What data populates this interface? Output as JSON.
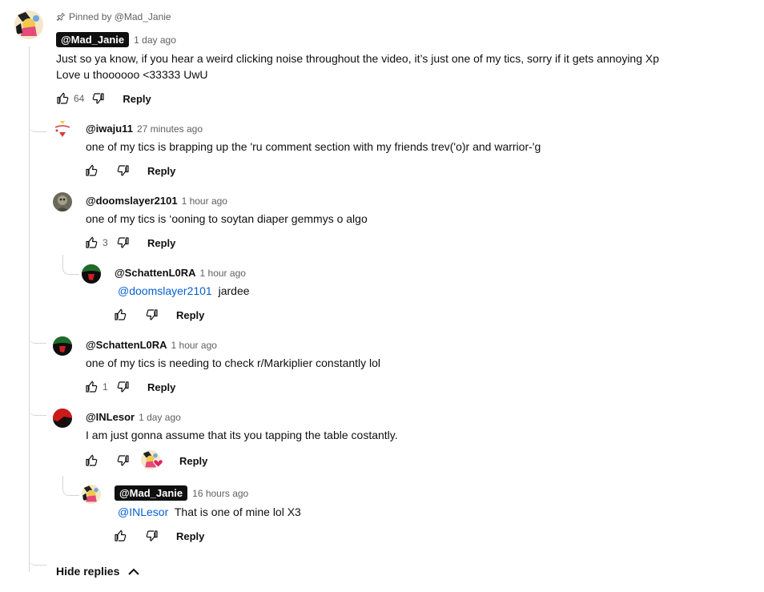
{
  "pinned": {
    "pin_text": "Pinned by @Mad_Janie",
    "handle": "@Mad_Janie",
    "time": "1 day ago",
    "lines": [
      "Just so ya know, if you hear a weird clicking noise throughout the video, it’s just one of my tics, sorry if it gets annoying Xp",
      "Love u thoooooo <33333 UwU"
    ],
    "likes": "64",
    "reply_label": "Reply"
  },
  "replies": [
    {
      "handle": "@iwaju11",
      "time": "27 minutes ago",
      "text": "one of my tics is brapping up the 'ru comment section with my friends trev('o)r and warrior-'g",
      "likes": "",
      "reply_label": "Reply"
    },
    {
      "handle": "@doomslayer2101",
      "time": "1 hour ago",
      "text": "one of my tics is ‘ooning to soytan diaper gemmys o algo",
      "likes": "3",
      "reply_label": "Reply"
    },
    {
      "handle": "@SchattenL0RA",
      "time": "1 hour ago",
      "mention": "@doomslayer2101",
      "text": "jardee",
      "likes": "",
      "reply_label": "Reply"
    },
    {
      "handle": "@SchattenL0RA",
      "time": "1 hour ago",
      "text": "one of my tics is needing to check r/Markiplier constantly lol",
      "likes": "1",
      "reply_label": "Reply"
    },
    {
      "handle": "@INLesor",
      "time": "1 day ago",
      "text": "I am just gonna assume that its you tapping the table costantly.",
      "likes": "",
      "reply_label": "Reply"
    },
    {
      "handle": "@Mad_Janie",
      "time": "16 hours ago",
      "mention": "@INLesor",
      "text": "That is one of mine lol X3",
      "likes": "",
      "reply_label": "Reply"
    }
  ],
  "hide_replies": "Hide replies",
  "colors": {
    "accent_link": "#065fd4",
    "pill_bg": "#0f0f0f",
    "muted": "#606060"
  }
}
